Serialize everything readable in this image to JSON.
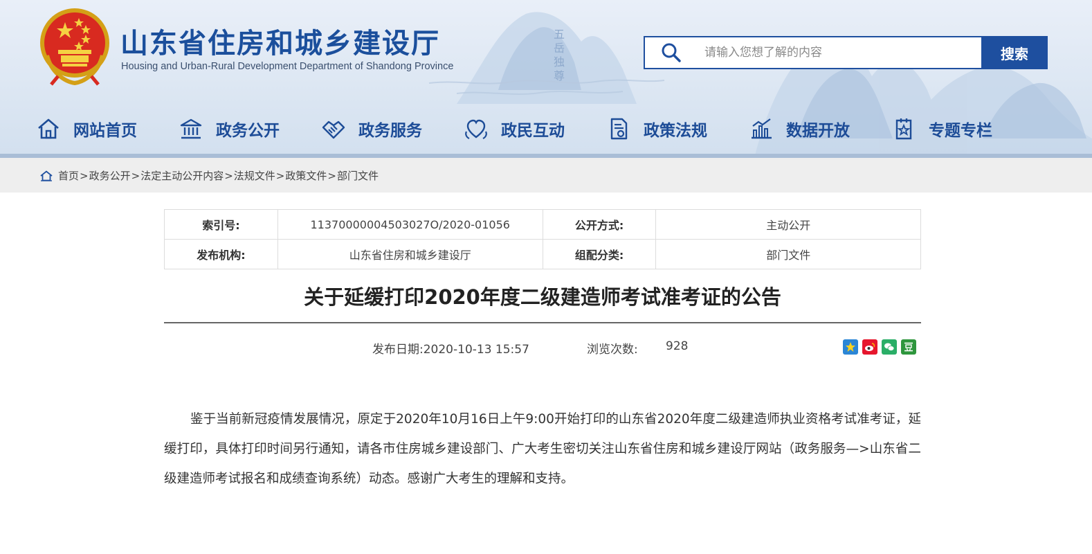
{
  "header": {
    "title": "山东省住房和城乡建设厅",
    "subtitle": "Housing and Urban-Rural Development Department of Shandong Province",
    "emblem_icon": "national-emblem-icon"
  },
  "search": {
    "placeholder": "请输入您想了解的内容",
    "button_label": "搜索",
    "icon": "search-icon"
  },
  "nav": {
    "items": [
      {
        "label": "网站首页",
        "icon": "home-icon"
      },
      {
        "label": "政务公开",
        "icon": "government-building-icon"
      },
      {
        "label": "政务服务",
        "icon": "handshake-icon"
      },
      {
        "label": "政民互动",
        "icon": "interaction-icon"
      },
      {
        "label": "政策法规",
        "icon": "document-icon"
      },
      {
        "label": "数据开放",
        "icon": "bar-chart-icon"
      },
      {
        "label": "专题专栏",
        "icon": "star-document-icon"
      }
    ]
  },
  "breadcrumb": {
    "items": [
      "首页",
      "政务公开",
      "法定主动公开内容",
      "法规文件",
      "政策文件",
      "部门文件"
    ],
    "separator": ">"
  },
  "meta": {
    "index_label": "索引号:",
    "index_value": "11370000004503027O/2020-01056",
    "disclosure_label": "公开方式:",
    "disclosure_value": "主动公开",
    "publisher_label": "发布机构:",
    "publisher_value": "山东省住房和城乡建设厅",
    "category_label": "组配分类:",
    "category_value": "部门文件"
  },
  "article": {
    "title": "关于延缓打印2020年度二级建造师考试准考证的公告",
    "date_text": "发布日期:2020-10-13 15:57",
    "views_label": "浏览次数:",
    "views_value": "928",
    "body": "鉴于当前新冠疫情发展情况，原定于2020年10月16日上午9:00开始打印的山东省2020年度二级建造师执业资格考试准考证，延缓打印，具体打印时间另行通知，请各市住房城乡建设部门、广大考生密切关注山东省住房和城乡建设厅网站（政务服务—>山东省二级建造师考试报名和成绩查询系统）动态。感谢广大考生的理解和支持。"
  },
  "share": {
    "items": [
      {
        "name": "qzone-share-icon",
        "color": "#2b86d6"
      },
      {
        "name": "weibo-share-icon",
        "color": "#e6162d"
      },
      {
        "name": "wechat-share-icon",
        "color": "#2aae67"
      },
      {
        "name": "douban-share-icon",
        "color": "#2e963d"
      }
    ]
  },
  "colors": {
    "brand_blue": "#1e4f9f",
    "nav_text": "#1d4c97",
    "crumb_bg": "#eeeeee"
  }
}
